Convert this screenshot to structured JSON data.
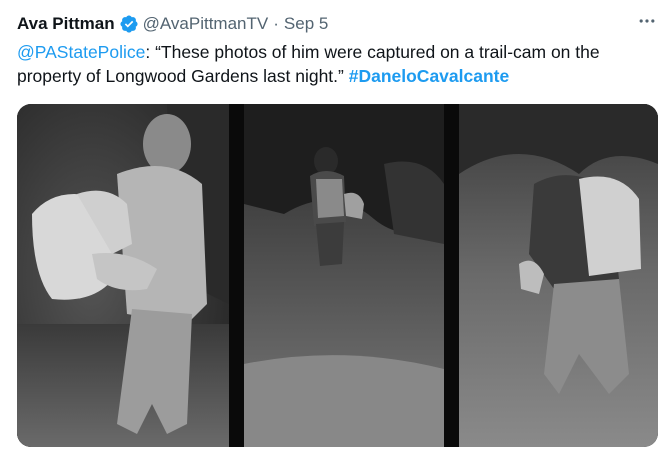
{
  "author": {
    "display_name": "Ava Pittman",
    "handle": "@AvaPittmanTV",
    "separator": "·",
    "date": "Sep 5",
    "verified_icon": "verified-badge-icon",
    "verified_color": "#1d9bf0"
  },
  "menu": {
    "icon": "more-horizontal-icon"
  },
  "tweet": {
    "mention": "@PAStatePolice",
    "body": ": “These photos of him were captured on a trail-cam on the property of Longwood Gardens last night.” ",
    "hashtag": "#DaneloCavalcante"
  },
  "colors": {
    "link": "#1d9bf0",
    "text": "#0f1419",
    "muted": "#536471"
  }
}
